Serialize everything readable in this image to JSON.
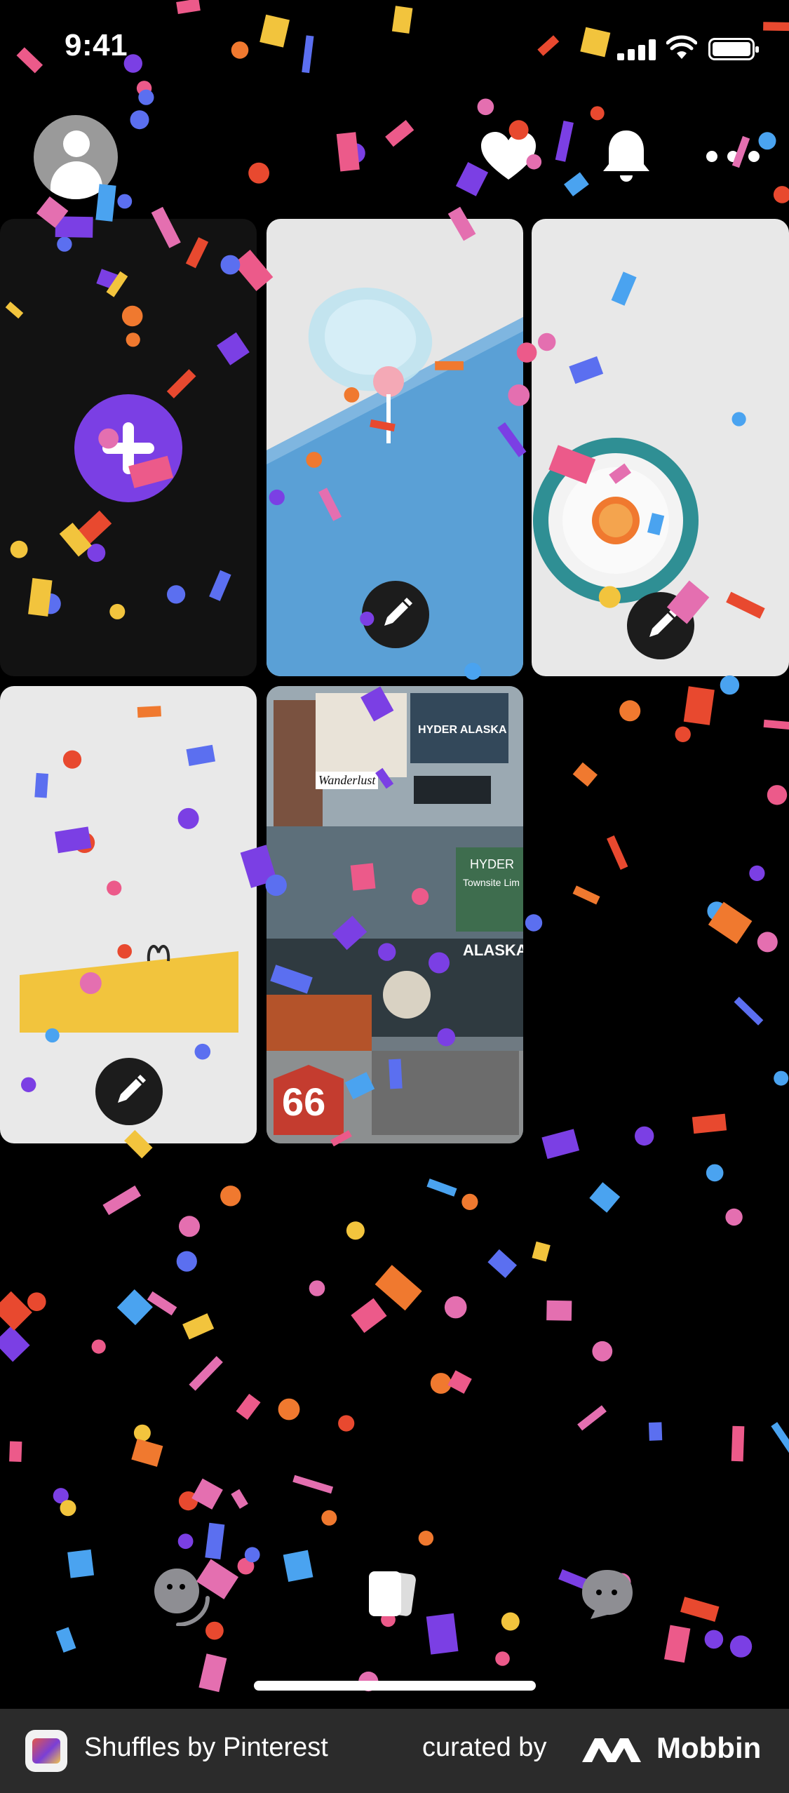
{
  "status_bar": {
    "time": "9:41"
  },
  "header": {
    "avatar_icon": "user-avatar-icon",
    "icons": [
      "heart-icon",
      "bell-icon",
      "more-icon"
    ]
  },
  "grid": {
    "tiles": [
      {
        "name": "create-new-tile",
        "icon": "plus-icon"
      },
      {
        "name": "lollipop-collage-tile",
        "icon": "pencil-icon"
      },
      {
        "name": "grapefruit-plate-tile",
        "icon": "pencil-icon"
      },
      {
        "name": "yellow-chair-tile",
        "icon": "pencil-icon"
      },
      {
        "name": "travel-collage-tile"
      }
    ],
    "collage_texts": {
      "wanderlust": "Wanderlust",
      "hyder": "HYDER ALASKA",
      "sign": "HYDER",
      "sign2": "Townsite Lim",
      "alaska": "ALASKA",
      "route": "66"
    }
  },
  "bottom_nav": {
    "icons": [
      "emoji-icon",
      "shuffles-home-icon",
      "chat-icon"
    ]
  },
  "footer": {
    "app_name": "Shuffles by Pinterest",
    "curated_by": "curated by",
    "brand": "Mobbin"
  },
  "colors": {
    "accent_purple": "#7b3fe4",
    "background": "#000000",
    "footer_bg": "#2b2b2b"
  }
}
